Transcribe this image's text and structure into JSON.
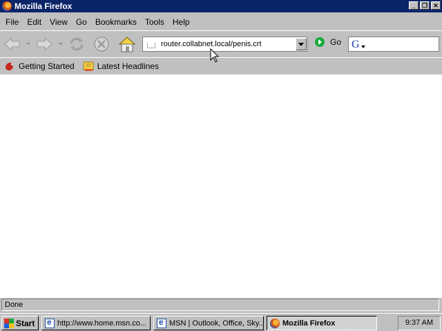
{
  "window": {
    "title": "Mozilla Firefox"
  },
  "menu": {
    "items": [
      {
        "label": "File"
      },
      {
        "label": "Edit"
      },
      {
        "label": "View"
      },
      {
        "label": "Go"
      },
      {
        "label": "Bookmarks"
      },
      {
        "label": "Tools"
      },
      {
        "label": "Help"
      }
    ]
  },
  "toolbar": {
    "url_value": "router.collabnet.local/penis.crt",
    "go_label": "Go",
    "search_value": ""
  },
  "bookmarks": {
    "items": [
      {
        "label": "Getting Started",
        "icon": "firefox-bookmark-icon"
      },
      {
        "label": "Latest Headlines",
        "icon": "rss-feed-icon"
      }
    ]
  },
  "status": {
    "text": "Done"
  },
  "taskbar": {
    "start_label": "Start",
    "tasks": [
      {
        "label": "http://www.home.msn.co...",
        "icon": "ie-icon"
      },
      {
        "label": "MSN | Outlook, Office, Sky...",
        "icon": "ie-icon"
      },
      {
        "label": "Mozilla Firefox",
        "icon": "firefox-icon",
        "active": true
      }
    ],
    "clock": "9:37 AM"
  }
}
